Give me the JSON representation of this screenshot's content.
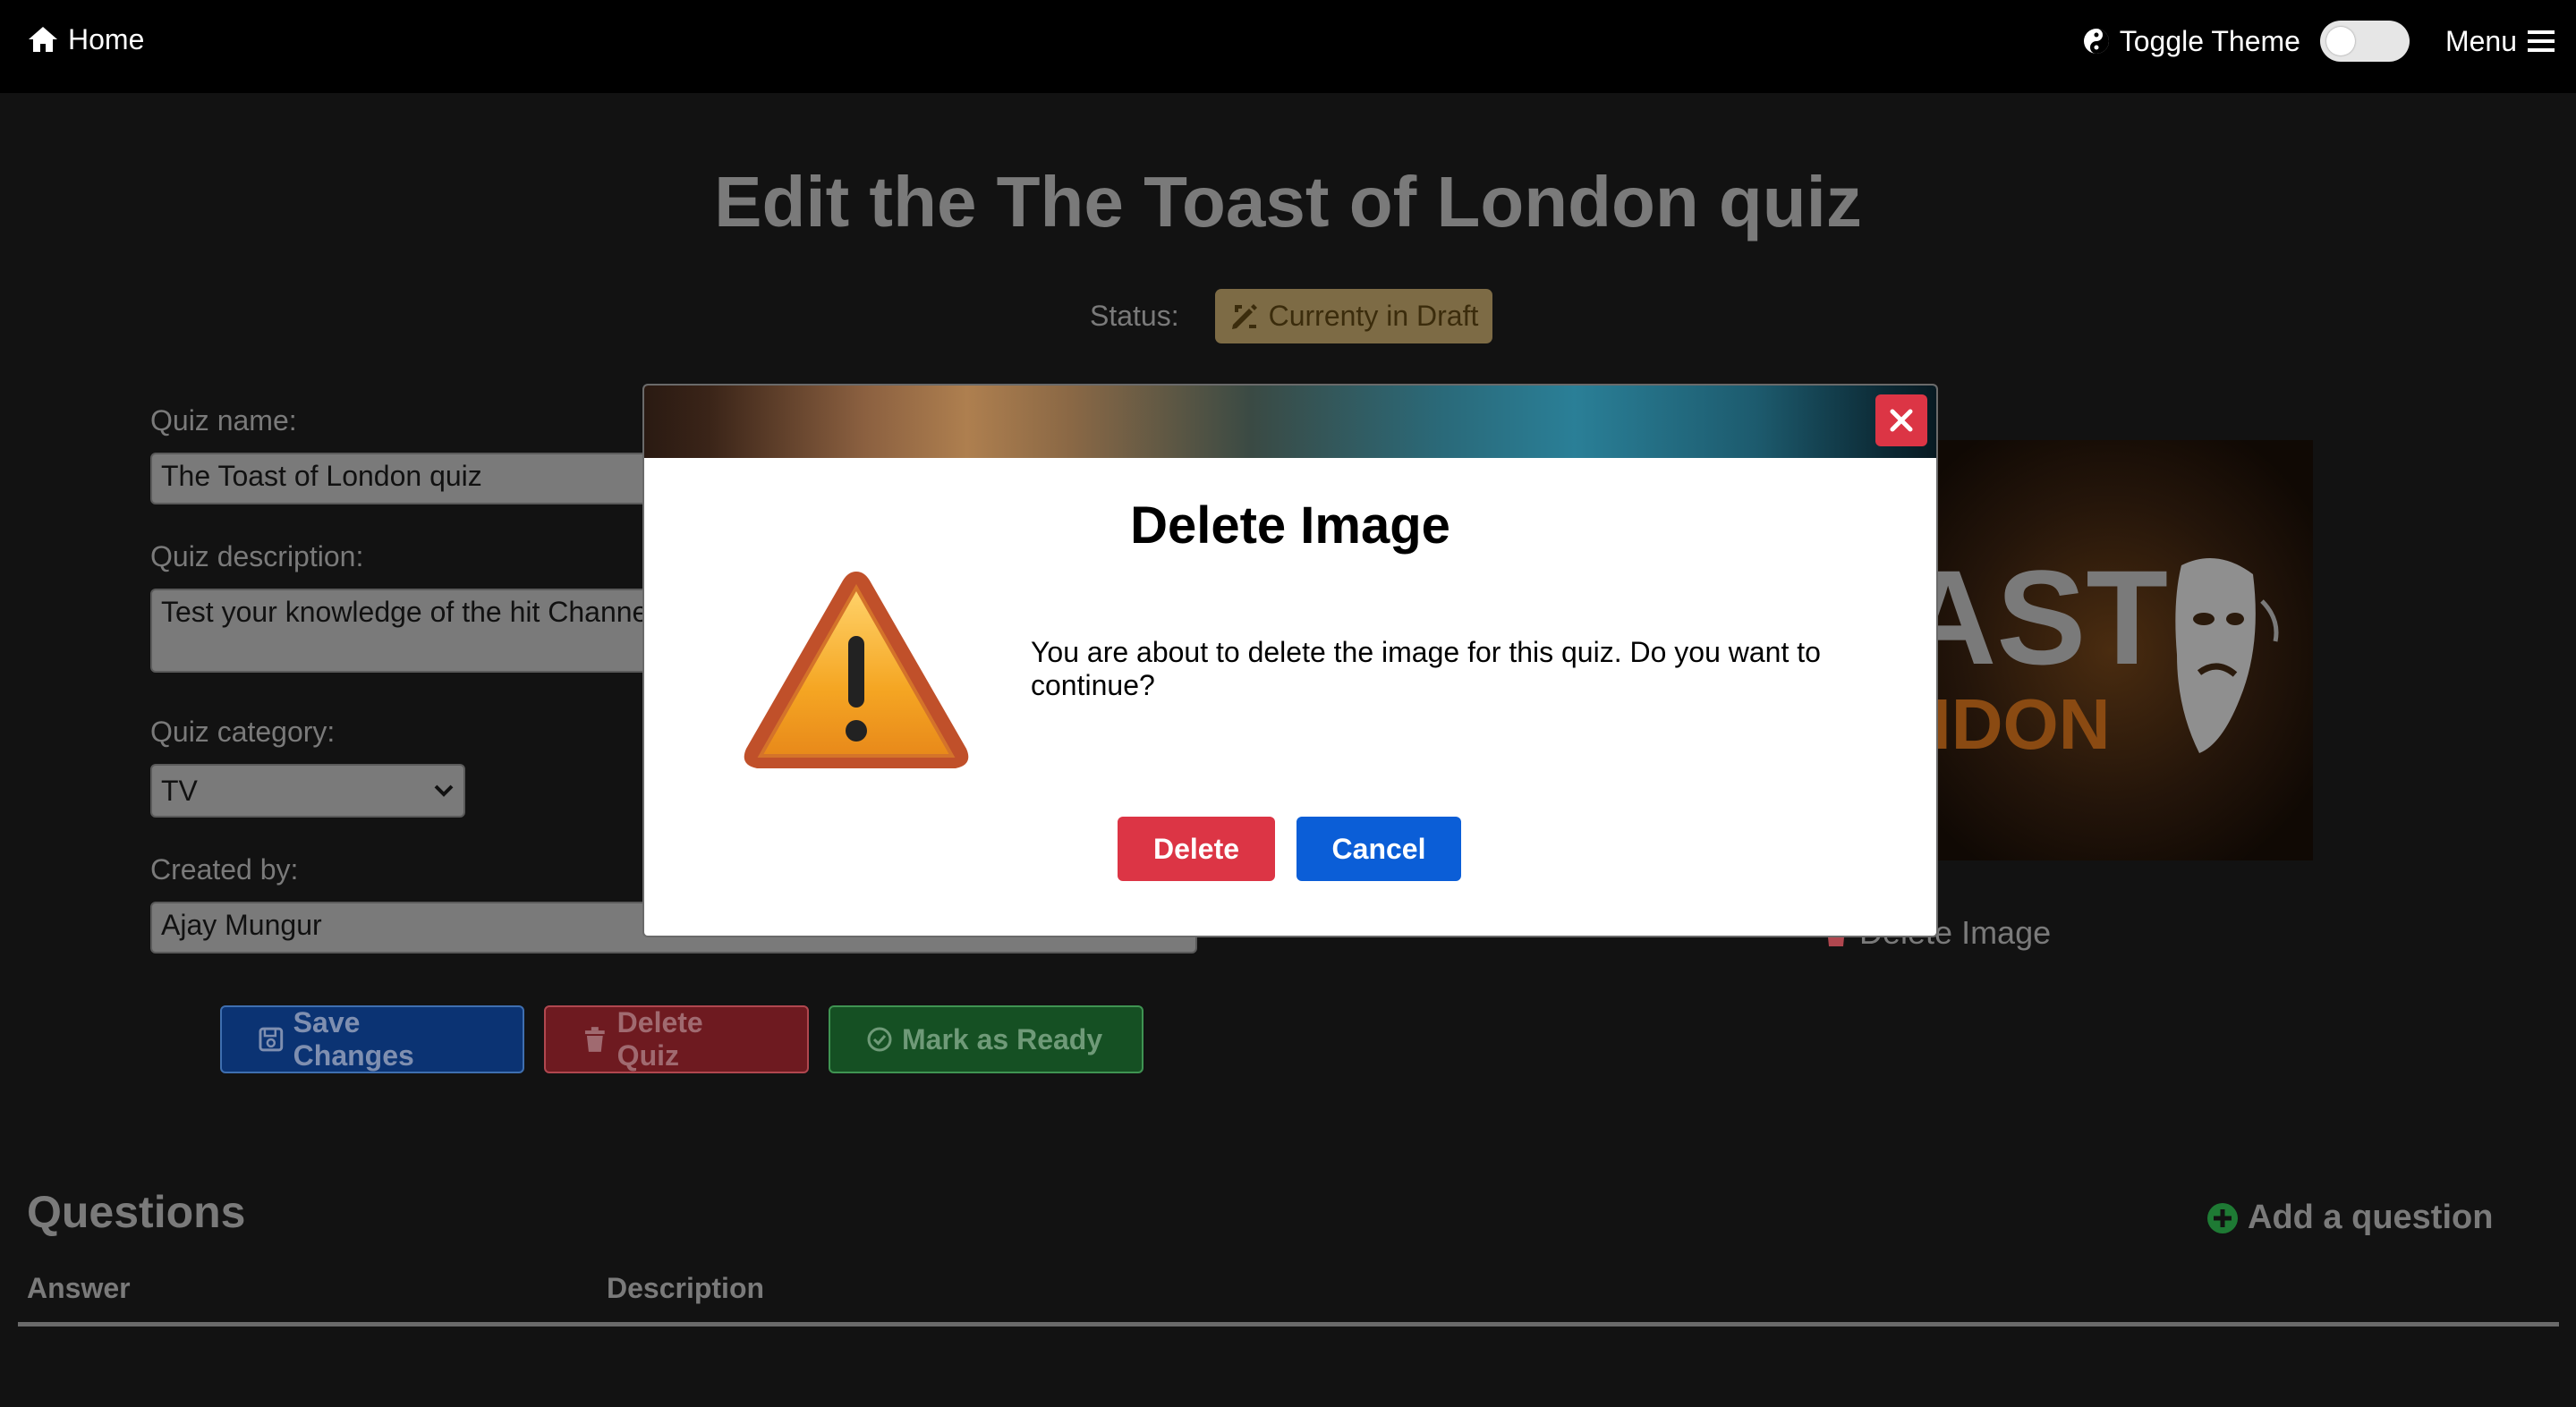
{
  "nav": {
    "home_label": "Home",
    "toggle_label": "Toggle Theme",
    "menu_label": "Menu"
  },
  "page": {
    "title": "Edit the The Toast of London quiz",
    "status_label": "Status:",
    "status_badge": "Currenty in Draft"
  },
  "form": {
    "name_label": "Quiz name:",
    "name_value": "The Toast of London quiz",
    "description_label": "Quiz description:",
    "description_value": "Test your knowledge of the hit Channe",
    "category_label": "Quiz category:",
    "category_value": "TV",
    "created_by_label": "Created by:",
    "created_by_value": "Ajay Mungur"
  },
  "actions": {
    "save_label": "Save Changes",
    "delete_label": "Delete Quiz",
    "ready_label": "Mark as Ready"
  },
  "image_panel": {
    "delete_image_label": "Delete Image",
    "logo_line1": "AST",
    "logo_line2": "NDON"
  },
  "questions": {
    "title": "Questions",
    "add_label": "Add a question",
    "columns": [
      "Answer",
      "Description"
    ]
  },
  "modal": {
    "title": "Delete Image",
    "message": "You are about to delete the image for this quiz. Do you want to continue?",
    "delete_label": "Delete",
    "cancel_label": "Cancel"
  },
  "colors": {
    "danger": "#dc3545",
    "primary": "#0b5ed7",
    "draft_badge": "#7d6b45"
  }
}
